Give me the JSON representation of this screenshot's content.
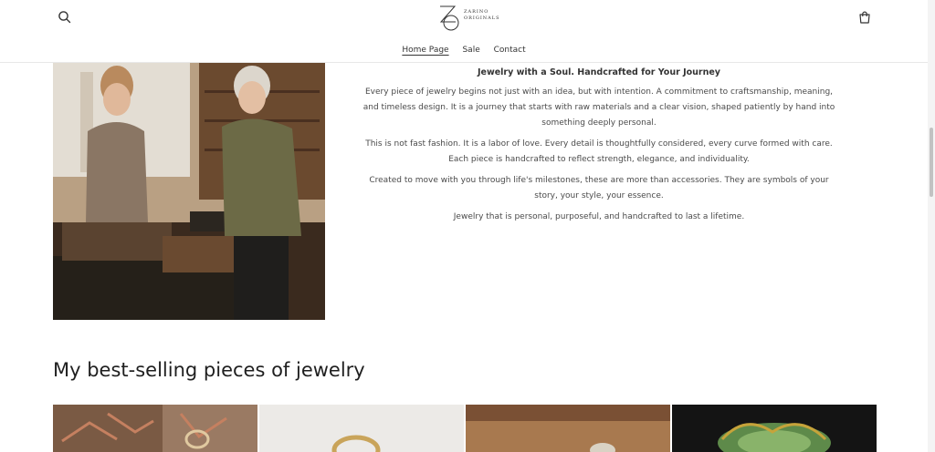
{
  "brand": {
    "monogram": "ZO",
    "line1": "ZARINO",
    "line2": "ORIGINALS"
  },
  "header": {
    "search_icon": "search-icon",
    "cart_icon": "cart-icon"
  },
  "nav": {
    "items": [
      {
        "label": "Home Page",
        "active": true
      },
      {
        "label": "Sale",
        "active": false
      },
      {
        "label": "Contact",
        "active": false
      }
    ]
  },
  "story": {
    "title": "Jewelry with a Soul. Handcrafted for Your Journey",
    "paragraphs": [
      "Every piece of jewelry begins not just with an idea, but with intention. A commitment to craftsmanship, meaning, and timeless design. It is a journey that starts with raw materials and a clear vision, shaped patiently by hand into something deeply personal.",
      "This is not fast fashion. It is a labor of love. Every detail is thoughtfully considered, every curve formed with care. Each piece is handcrafted to reflect strength, elegance, and individuality.",
      "Created to move with you through life's milestones, these are more than accessories. They are symbols of your story, your style, your essence.",
      "Jewelry that is personal, purposeful, and handcrafted to last a lifetime."
    ]
  },
  "bestsellers": {
    "heading": "My best-selling pieces of jewelry"
  },
  "colors": {
    "text": "#333333",
    "border": "#e8e8e8",
    "background": "#ffffff"
  }
}
